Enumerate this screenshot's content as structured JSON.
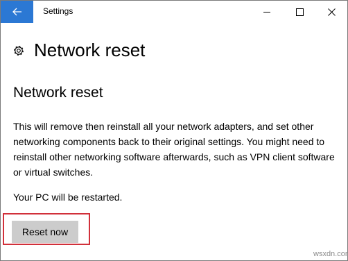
{
  "window": {
    "title": "Settings"
  },
  "header": {
    "title": "Network reset",
    "icon": "gear-icon"
  },
  "section": {
    "title": "Network reset",
    "description": "This will remove then reinstall all your network adapters, and set other networking components back to their original settings. You might need to reinstall other networking software afterwards, such as VPN client software or virtual switches.",
    "restart_note": "Your PC will be restarted."
  },
  "actions": {
    "reset_label": "Reset now"
  },
  "watermark": "wsxdn.com",
  "colors": {
    "back_button": "#2b78d4",
    "reset_button": "#cccccc",
    "highlight_box": "#d1303a"
  }
}
